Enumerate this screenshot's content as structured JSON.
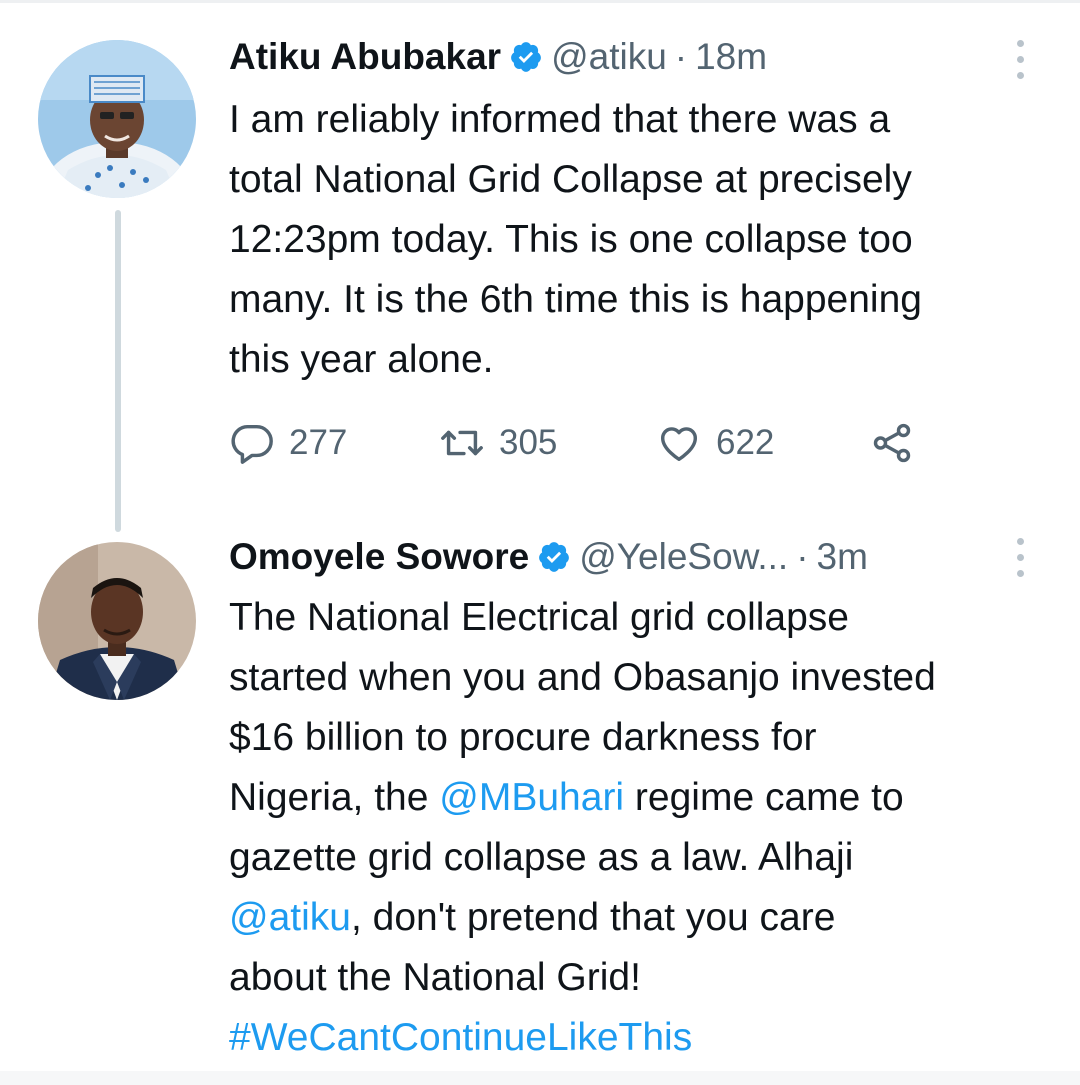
{
  "tweets": [
    {
      "name": "Atiku Abubakar",
      "handle": "@atiku",
      "separator": "·",
      "time": "18m",
      "text_lines": [
        "I am reliably informed that there was a",
        "total National Grid Collapse at precisely",
        "12:23pm today. This is one collapse too",
        "many. It is the 6th time this is happening",
        "this year alone."
      ],
      "replies": "277",
      "retweets": "305",
      "likes": "622"
    },
    {
      "name": "Omoyele Sowore",
      "handle": "@YeleSow...",
      "separator": "·",
      "time": "3m",
      "text_lines": {
        "l1": "The National Electrical grid collapse",
        "l2": "started when you and Obasanjo invested",
        "l3": "$16 billion to procure darkness for",
        "l4_a": "Nigeria, the ",
        "l4_link": "@MBuhari",
        "l4_b": " regime came to",
        "l5": "gazette grid collapse as a law. Alhaji",
        "l6_link": "@atiku",
        "l6_b": ", don't pretend that you care",
        "l7": "about the National Grid!",
        "l8_link": "#WeCantContinueLikeThis"
      }
    }
  ],
  "icons": {
    "verified": "verified-badge-icon",
    "more": "more-options-icon",
    "reply": "reply-icon",
    "retweet": "retweet-icon",
    "like": "heart-icon",
    "share": "share-icon"
  },
  "colors": {
    "link": "#1d9bf0",
    "secondary_text": "#536471",
    "thread_line": "#cfd9de"
  }
}
